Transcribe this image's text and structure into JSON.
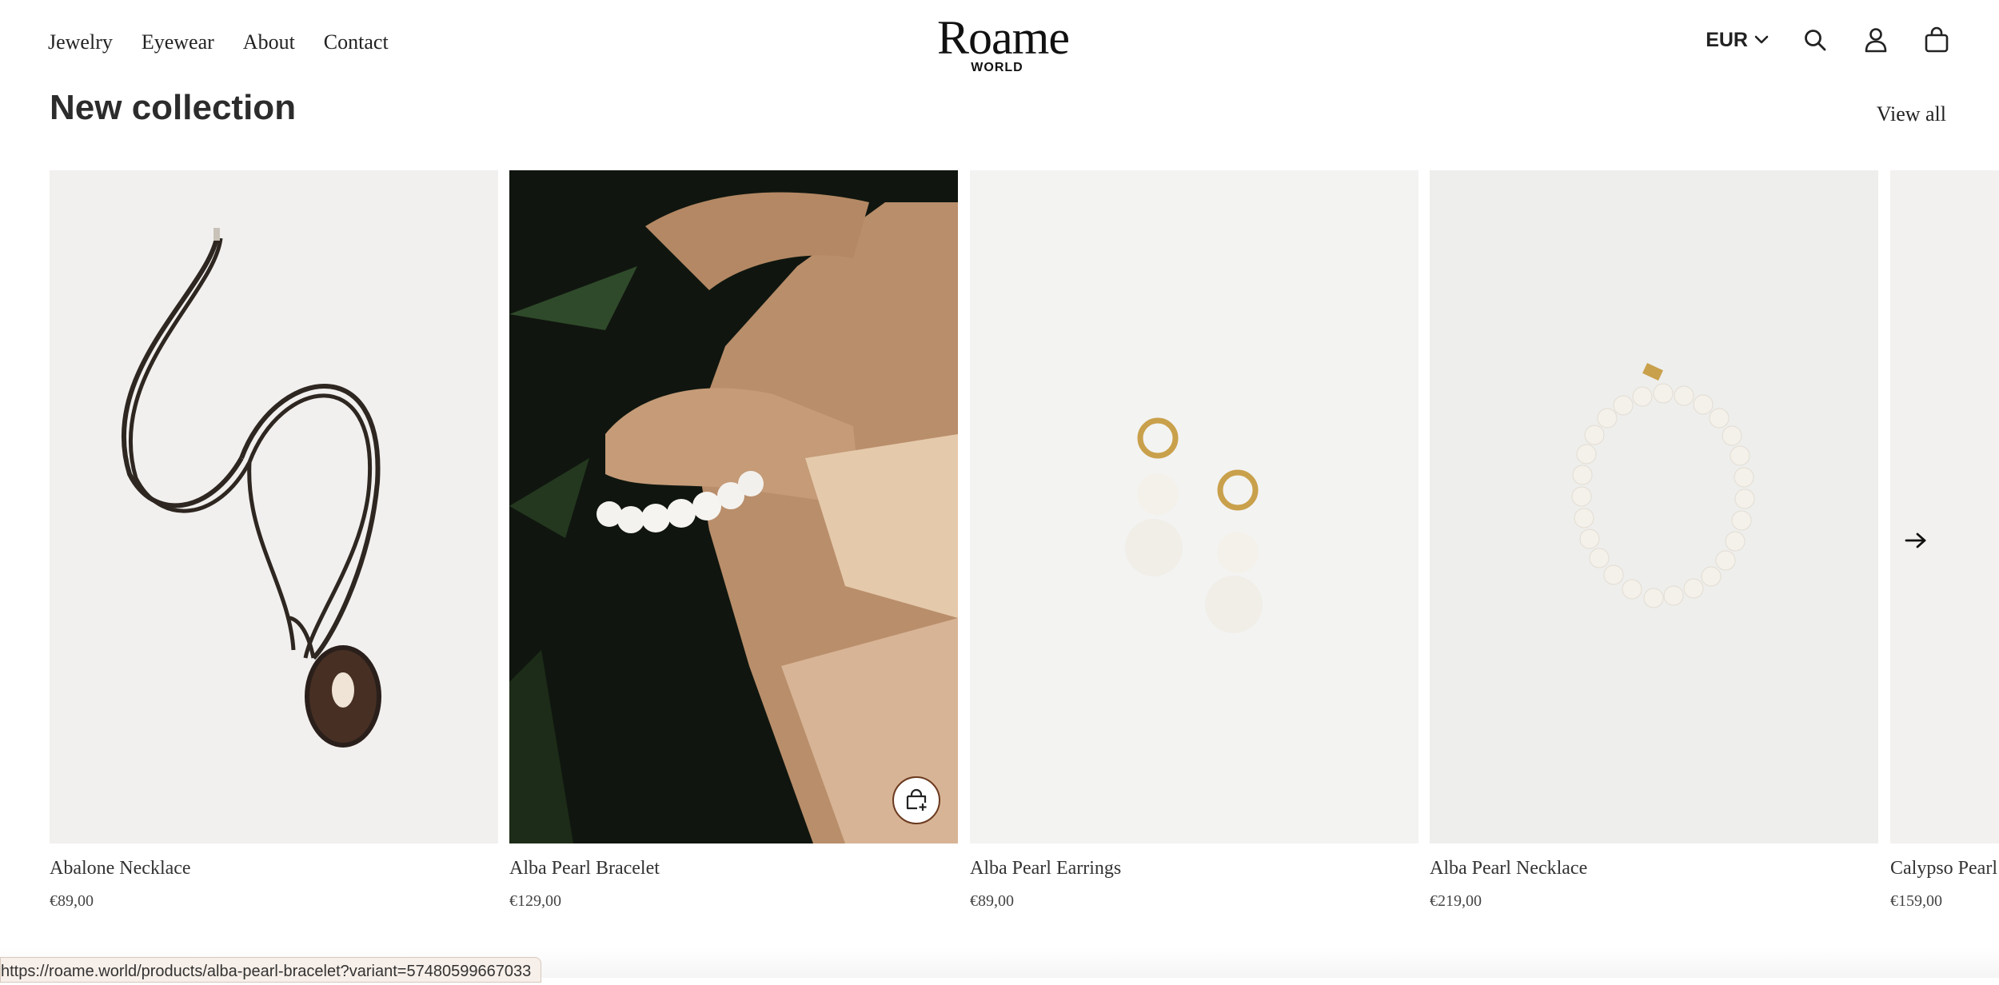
{
  "header": {
    "nav": [
      "Jewelry",
      "Eyewear",
      "About",
      "Contact"
    ],
    "logo_main": "Roame",
    "logo_sub": "WORLD",
    "currency": "EUR",
    "icons": [
      "chevron-down-icon",
      "search-icon",
      "account-icon",
      "cart-icon"
    ]
  },
  "section": {
    "title": "New collection",
    "view_all": "View all"
  },
  "products": [
    {
      "name": "Abalone Necklace",
      "price": "€89,00"
    },
    {
      "name": "Alba Pearl Bracelet",
      "price": "€129,00"
    },
    {
      "name": "Alba Pearl Earrings",
      "price": "€89,00"
    },
    {
      "name": "Alba Pearl Necklace",
      "price": "€219,00"
    },
    {
      "name": "Calypso Pearl",
      "price": "€159,00"
    }
  ],
  "status_url": "https://roame.world/products/alba-pearl-bracelet?variant=57480599667033",
  "colors": {
    "accent_border": "#6b3a1f",
    "text": "#222222",
    "bg": "#ffffff"
  }
}
